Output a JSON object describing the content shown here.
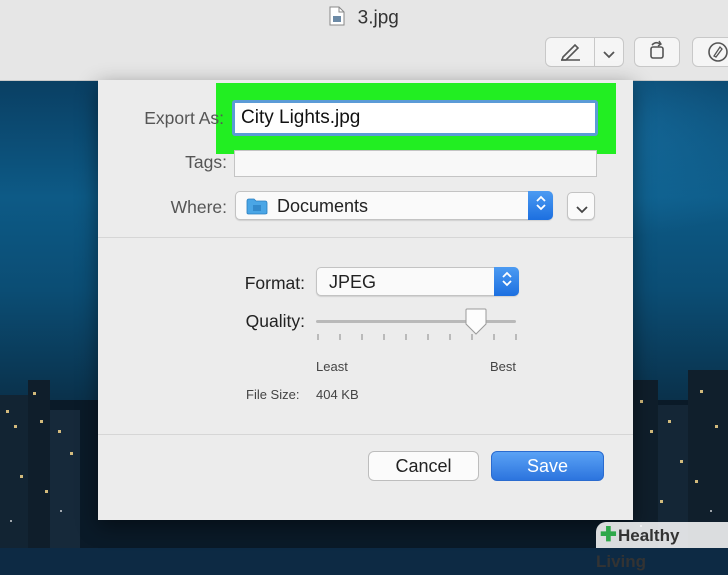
{
  "window": {
    "title": "3.jpg"
  },
  "toolbar": {
    "icons": [
      "pen-icon",
      "chevron-down-icon",
      "rotate-icon",
      "markup-icon"
    ]
  },
  "export_sheet": {
    "export_as_label": "Export As:",
    "export_as_value": "City Lights.jpg",
    "tags_label": "Tags:",
    "tags_value": "",
    "where_label": "Where:",
    "where_value": "Documents",
    "format_label": "Format:",
    "format_value": "JPEG",
    "quality_label": "Quality:",
    "quality_value": 0.8,
    "quality_min_label": "Least",
    "quality_max_label": "Best",
    "file_size_label": "File Size:",
    "file_size_value": "404 KB",
    "cancel_label": "Cancel",
    "save_label": "Save"
  },
  "watermark": {
    "text": "Healthy Living"
  },
  "colors": {
    "highlight": "#22ee22",
    "accent": "#2c74de"
  }
}
